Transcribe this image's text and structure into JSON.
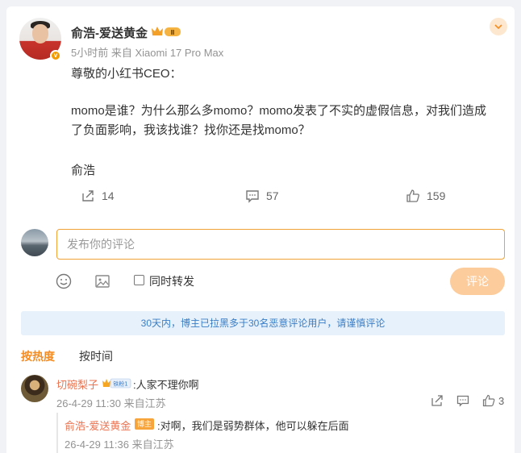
{
  "post": {
    "author": "俞浩-爱送黄金",
    "time": "5小时前",
    "source": "来自 Xiaomi 17 Pro Max",
    "greeting": "尊敬的小红书CEO：",
    "body_line1": "momo是谁？为什么那么多momo？momo发表了不实的虚假信息，对我们造成",
    "body_line2": "了负面影响，我该找谁？找你还是找momo？",
    "signature": "俞浩",
    "reposts": "14",
    "comments": "57",
    "likes": "159"
  },
  "composer": {
    "placeholder": "发布你的评论",
    "repost_label": "同时转发",
    "submit_label": "评论"
  },
  "notice": "30天内，博主已拉黑多于30名恶意评论用户，请谨慎评论",
  "sort": {
    "hot": "按热度",
    "time": "按时间"
  },
  "comments": [
    {
      "name": "切碗梨子",
      "fan_badge": "铁粉1",
      "text": ":人家不理你啊",
      "time": "26-4-29 11:30",
      "location": "来自江苏",
      "likes": "3",
      "reply": {
        "name": "俞浩-爱送黄金",
        "badge": "博主",
        "text": ":对啊，我们是弱势群体，他可以躲在后面",
        "time": "26-4-29 11:36",
        "location": "来自江苏"
      }
    }
  ],
  "colors": {
    "accent": "#f58c22",
    "name": "#eb7350",
    "notice_bg": "#e6f1fb",
    "notice_text": "#3b7ec6"
  }
}
